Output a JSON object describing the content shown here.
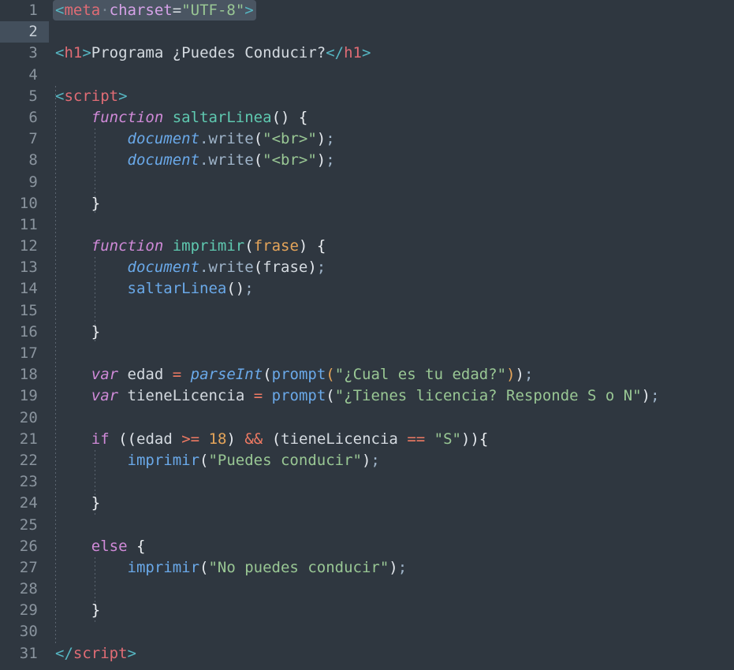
{
  "editor": {
    "name": "code-editor",
    "language": "html",
    "theme": "dark",
    "background_color": "#2f3740",
    "gutter_color": "#2f3740",
    "active_line_number": 2,
    "active_line_highlight_color": "#434f5c",
    "selection_highlight_color": "#4a5562",
    "line_number_color": "#8a949e",
    "total_lines": 31,
    "font_size_px": 19,
    "line_height_px": 27.2
  },
  "colors": {
    "tag_bracket": "#56b6c2",
    "tag_name": "#e06c75",
    "attribute": "#d6a2e8",
    "string": "#99c794",
    "keyword": "#d08ad8",
    "function_name": "#5fc9b0",
    "function_call": "#6aa9e9",
    "object": "#6aa9e9",
    "parameter": "#e5a55a",
    "number": "#e5a55a",
    "operator": "#ef7a63",
    "plain_text": "#d4dae0"
  },
  "line_numbers": [
    "1",
    "2",
    "3",
    "4",
    "5",
    "6",
    "7",
    "8",
    "9",
    "10",
    "11",
    "12",
    "13",
    "14",
    "15",
    "16",
    "17",
    "18",
    "19",
    "20",
    "21",
    "22",
    "23",
    "24",
    "25",
    "26",
    "27",
    "28",
    "29",
    "30",
    "31"
  ],
  "code": {
    "full_text": "<meta charset=\"UTF-8\">\n\n<h1>Programa ¿Puedes Conducir?</h1>\n\n<script>\n    function saltarLinea() {\n        document.write(\"<br>\");\n        document.write(\"<br>\");\n\n    }\n\n    function imprimir(frase) {\n        document.write(frase);\n        saltarLinea();\n\n    }\n\n    var edad = parseInt(prompt(\"¿Cual es tu edad?\"));\n    var tieneLicencia = prompt(\"¿Tienes licencia? Responde S o N\");\n\n    if ((edad >= 18) && (tieneLicencia == \"S\")){\n        imprimir(\"Puedes conducir\");\n\n    }\n\n    else {\n        imprimir(\"No puedes conducir\");\n\n    }\n\n</scr"
  },
  "lines": {
    "l1": {
      "bracket_open": "<",
      "tag": "meta",
      "space_dot": "·",
      "attr": "charset",
      "eq": "=",
      "value": "\"UTF-8\"",
      "bracket_close": ">"
    },
    "l3": {
      "bracket_open": "<",
      "tag": "h1",
      "bracket_gt": ">",
      "text": "Programa ¿Puedes Conducir?",
      "close_open": "</",
      "close_tag": "h1",
      "close_gt": ">"
    },
    "l5": {
      "bracket_open": "<",
      "tag": "script",
      "bracket_gt": ">"
    },
    "l6": {
      "kw": "function",
      "name": "saltarLinea",
      "parens": "()",
      "brace": "{"
    },
    "l7": {
      "obj": "document",
      "dot": ".",
      "method": "write",
      "paren_open": "(",
      "string": "\"<br>\"",
      "paren_close": ")",
      "semi": ";"
    },
    "l8": {
      "obj": "document",
      "dot": ".",
      "method": "write",
      "paren_open": "(",
      "string": "\"<br>\"",
      "paren_close": ")",
      "semi": ";"
    },
    "l10": {
      "brace": "}"
    },
    "l12": {
      "kw": "function",
      "name": "imprimir",
      "paren_open": "(",
      "param": "frase",
      "paren_close": ")",
      "brace": "{"
    },
    "l13": {
      "obj": "document",
      "dot": ".",
      "method": "write",
      "paren_open": "(",
      "arg": "frase",
      "paren_close": ")",
      "semi": ";"
    },
    "l14": {
      "call": "saltarLinea",
      "parens": "()",
      "semi": ";"
    },
    "l16": {
      "brace": "}"
    },
    "l18": {
      "kw": "var",
      "name": "edad",
      "eq": "=",
      "fn1": "parseInt",
      "p1": "(",
      "fn2": "prompt",
      "p2": "(",
      "string": "\"¿Cual es tu edad?\"",
      "p3": ")",
      "p4": ")",
      "semi": ";"
    },
    "l19": {
      "kw": "var",
      "name": "tieneLicencia",
      "eq": "=",
      "fn": "prompt",
      "p1": "(",
      "string": "\"¿Tienes licencia? Responde S o N\"",
      "p2": ")",
      "semi": ";"
    },
    "l21": {
      "kw": "if",
      "p1": "((",
      "var1": "edad",
      "op1": ">=",
      "num": "18",
      "p2": ")",
      "op2": "&&",
      "p3": "(",
      "var2": "tieneLicencia",
      "op3": "==",
      "string": "\"S\"",
      "p4": "))",
      "brace": "{"
    },
    "l22": {
      "call": "imprimir",
      "p1": "(",
      "string": "\"Puedes conducir\"",
      "p2": ")",
      "semi": ";"
    },
    "l24": {
      "brace": "}"
    },
    "l26": {
      "kw": "else",
      "brace": "{"
    },
    "l27": {
      "call": "imprimir",
      "p1": "(",
      "string": "\"No puedes conducir\"",
      "p2": ")",
      "semi": ";"
    },
    "l29": {
      "brace": "}"
    },
    "l31": {
      "close_open": "</",
      "tag": "script",
      "close_gt": ">"
    }
  }
}
